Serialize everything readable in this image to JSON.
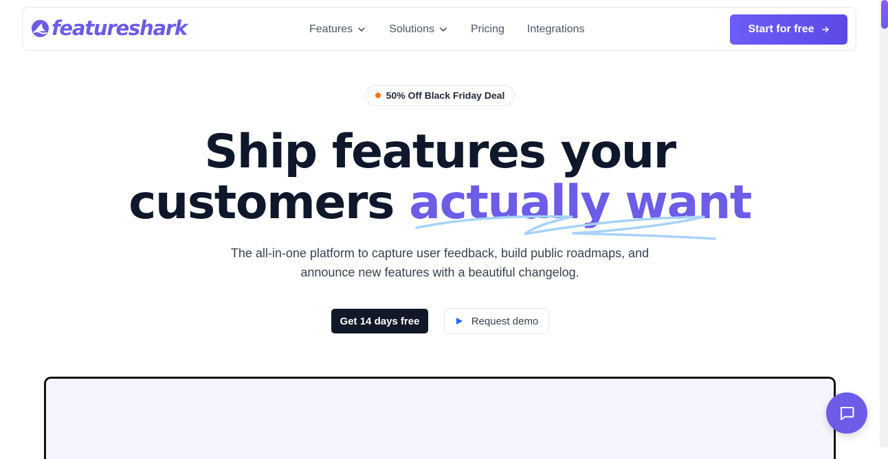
{
  "brand": {
    "name": "featureshark",
    "color": "#6b5ce8"
  },
  "nav": {
    "items": [
      {
        "label": "Features",
        "has_dropdown": true
      },
      {
        "label": "Solutions",
        "has_dropdown": true
      },
      {
        "label": "Pricing",
        "has_dropdown": false
      },
      {
        "label": "Integrations",
        "has_dropdown": false
      }
    ],
    "cta_label": "Start for free"
  },
  "badge": {
    "text": "50% Off Black Friday Deal",
    "dot_color": "#f97316"
  },
  "hero": {
    "line1": "Ship features your",
    "line2_plain": "customers ",
    "line2_accent": "actually want",
    "accent_color": "#6d5ce8",
    "subtitle": "The all-in-one platform to capture user feedback, build public roadmaps, and announce new features with a beautiful changelog."
  },
  "buttons": {
    "primary_label": "Get 14 days free",
    "secondary_label": "Request demo"
  },
  "icons": {
    "logo": "shark-fin-logo-icon",
    "dropdown": "chevron-down-icon",
    "arrow": "arrow-right-icon",
    "play": "play-icon",
    "chat": "chat-bubble-icon"
  }
}
